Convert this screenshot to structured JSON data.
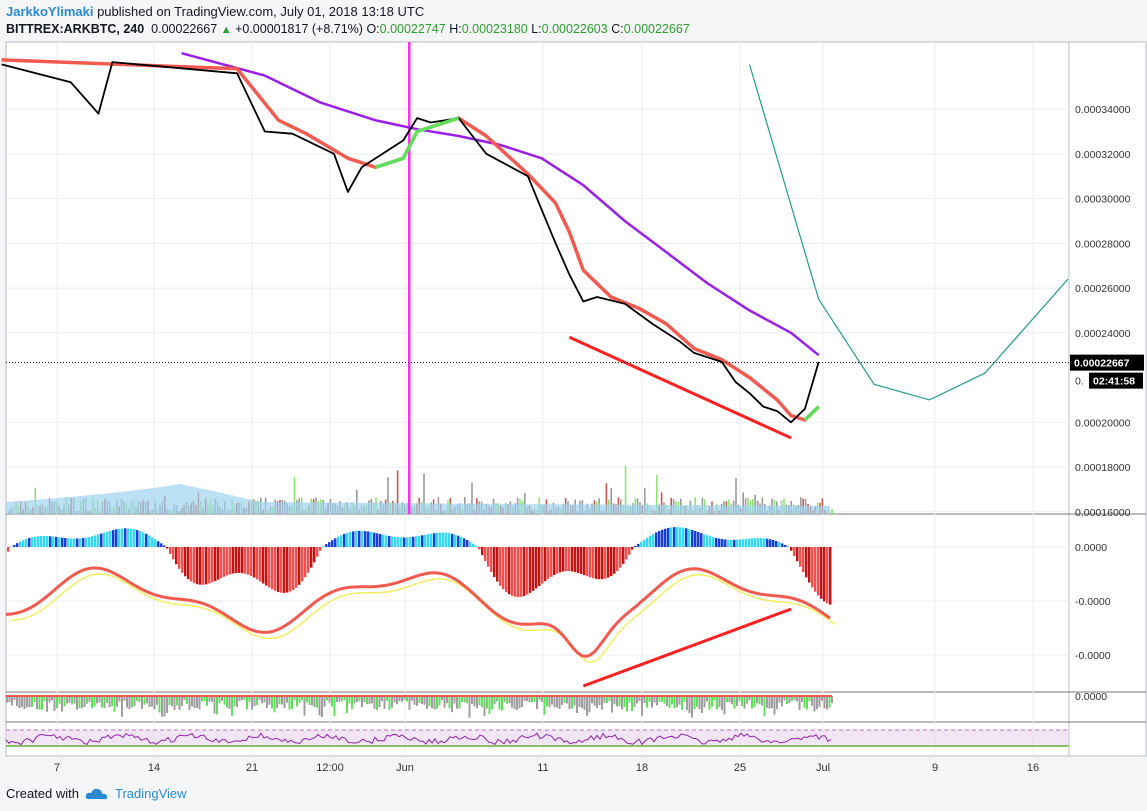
{
  "header": {
    "author": "JarkkoYlimaki",
    "published_text": "published on TradingView.com, July 01, 2018 13:18 UTC",
    "symbol": "BITTREX:ARKBTC, 240",
    "last": "0.00022667",
    "change_icon": "triangle-up-icon",
    "change": "+0.00001817 (+8.71%)",
    "o_label": "O:",
    "o": "0.00022747",
    "h_label": "H:",
    "h": "0.00023180",
    "l_label": "L:",
    "l": "0.00022603",
    "c_label": "C:",
    "c": "0.00022667"
  },
  "footer": {
    "created_with": "Created with",
    "brand": "TradingView",
    "logo_icon": "tradingview-cloud-icon"
  },
  "colors": {
    "price": "#000000",
    "ma_fast_down": "#f25a50",
    "ma_fast_up": "#5fe05a",
    "ma_slow": "#9b1fe8",
    "arc": "#1e9e8c",
    "vline": "#ff2df0",
    "trendline": "#ff2020",
    "volume_ma": "#9fd3f0",
    "hist_pos_dark": "#1a3fd6",
    "hist_pos_light": "#35d8f5",
    "hist_neg_dark": "#c01515",
    "hist_neg_light": "#f05050",
    "osc_up": "#5fe05a",
    "osc_down": "#f25a50",
    "osc_signal": "#f0f060",
    "rsi": "#8e24aa",
    "rsi_band": "#e8d4f0"
  },
  "chart_data": {
    "type": "line",
    "series": [
      {
        "name": "",
        "points": [
          [
            "May 3",
            0.00036
          ],
          [
            "May 8",
            0.000352
          ],
          [
            "May 10",
            0.000338
          ],
          [
            "May 11",
            0.000361
          ],
          [
            "May 20",
            0.000356
          ],
          [
            "May 22",
            0.00033
          ],
          [
            "May 24",
            0.000329
          ],
          [
            "May 27",
            0.00032
          ],
          [
            "May 28",
            0.000303
          ],
          [
            "May 29",
            0.000314
          ],
          [
            "May 30",
            0.000318
          ],
          [
            "Jun 1",
            0.000326
          ],
          [
            "Jun 2",
            0.000336
          ],
          [
            "Jun 3",
            0.000334
          ],
          [
            "Jun 5",
            0.000336
          ],
          [
            "Jun 7",
            0.00032
          ],
          [
            "Jun 10",
            0.00031
          ],
          [
            "Jun 11",
            0.000295
          ],
          [
            "Jun 12",
            0.00028
          ],
          [
            "Jun 13",
            0.000266
          ],
          [
            "Jun 14",
            0.000254
          ],
          [
            "Jun 15",
            0.000256
          ],
          [
            "Jun 17",
            0.000253
          ],
          [
            "Jun 19",
            0.000244
          ],
          [
            "Jun 21",
            0.000236
          ],
          [
            "Jun 22",
            0.000231
          ],
          [
            "Jun 24",
            0.000227
          ],
          [
            "Jun 25",
            0.000218
          ],
          [
            "Jun 26",
            0.000213
          ],
          [
            "Jun 27",
            0.000207
          ],
          [
            "Jun 28",
            0.000205
          ],
          [
            "Jun 29",
            0.0002
          ],
          [
            "Jun 30",
            0.000206
          ],
          [
            "Jul 1",
            0.000227
          ]
        ]
      },
      {
        "name": "",
        "points": [
          [
            "May 3",
            0.000362
          ],
          [
            "May 20",
            0.000358
          ],
          [
            "May 23",
            0.000335
          ],
          [
            "May 25",
            0.000329
          ],
          [
            "May 28",
            0.000318
          ],
          [
            "May 30",
            0.000314
          ],
          [
            "Jun 1",
            0.000318
          ],
          [
            "Jun 2",
            0.00033
          ],
          [
            "Jun 5",
            0.000336
          ],
          [
            "Jun 7",
            0.000328
          ],
          [
            "Jun 10",
            0.000311
          ],
          [
            "Jun 12",
            0.000298
          ],
          [
            "Jun 13",
            0.000285
          ],
          [
            "Jun 14",
            0.000268
          ],
          [
            "Jun 16",
            0.000256
          ],
          [
            "Jun 18",
            0.000251
          ],
          [
            "Jun 20",
            0.000244
          ],
          [
            "Jun 22",
            0.000233
          ],
          [
            "Jun 24",
            0.000228
          ],
          [
            "Jun 26",
            0.00022
          ],
          [
            "Jun 28",
            0.00021
          ],
          [
            "Jun 29",
            0.000203
          ],
          [
            "Jun 30",
            0.000201
          ],
          [
            "Jul 1",
            0.000207
          ]
        ]
      },
      {
        "name": "",
        "points": [
          [
            "May 16",
            0.000365
          ],
          [
            "May 22",
            0.000355
          ],
          [
            "May 26",
            0.000343
          ],
          [
            "May 30",
            0.000335
          ],
          [
            "Jun 2",
            0.000331
          ],
          [
            "Jun 5",
            0.000328
          ],
          [
            "Jun 8",
            0.000324
          ],
          [
            "Jun 11",
            0.000318
          ],
          [
            "Jun 14",
            0.000306
          ],
          [
            "Jun 17",
            0.00029
          ],
          [
            "Jun 20",
            0.000276
          ],
          [
            "Jun 23",
            0.000262
          ],
          [
            "Jun 26",
            0.00025
          ],
          [
            "Jun 29",
            0.00024
          ],
          [
            "Jul 1",
            0.00023
          ]
        ]
      }
    ],
    "arc": [
      [
        "Jun 26",
        0.00036
      ],
      [
        "Jul 1",
        0.000255
      ],
      [
        "Jul 5",
        0.000217
      ],
      [
        "Jul 9",
        0.00021
      ],
      [
        "Jul 13",
        0.000222
      ],
      [
        "Jul 19",
        0.000264
      ]
    ],
    "vertical_marker": "Jun 1",
    "price_trendline": [
      [
        "Jun 13",
        0.000238
      ],
      [
        "Jun 29",
        0.000193
      ]
    ],
    "oscillator_trendline": [
      [
        "Jun 14",
        -2.78e-06
      ],
      [
        "Jun 29",
        -1.32e-06
      ]
    ],
    "last_price_line": 0.00022667,
    "price_axis": {
      "ticks": [
        "0.00034000",
        "0.00032000",
        "0.00030000",
        "0.00028000",
        "0.00026000",
        "0.00024000",
        "0.00020000",
        "0.00018000",
        "0.00016000"
      ],
      "ylim": [
        0.000159,
        0.00037
      ]
    },
    "price_label": "0.00022667",
    "countdown_label": "02:41:58",
    "price_label_partial": "0.",
    "oscillator_axis": {
      "ticks": [
        "0.0000",
        "-0.0000",
        "-0.0000"
      ]
    },
    "lower_axis": {
      "ticks": [
        "0.0000"
      ]
    },
    "x_axis": {
      "ticks": [
        "7",
        "14",
        "21",
        "12:00",
        "Jun",
        "11",
        "18",
        "25",
        "Jul",
        "9",
        "16"
      ]
    }
  }
}
